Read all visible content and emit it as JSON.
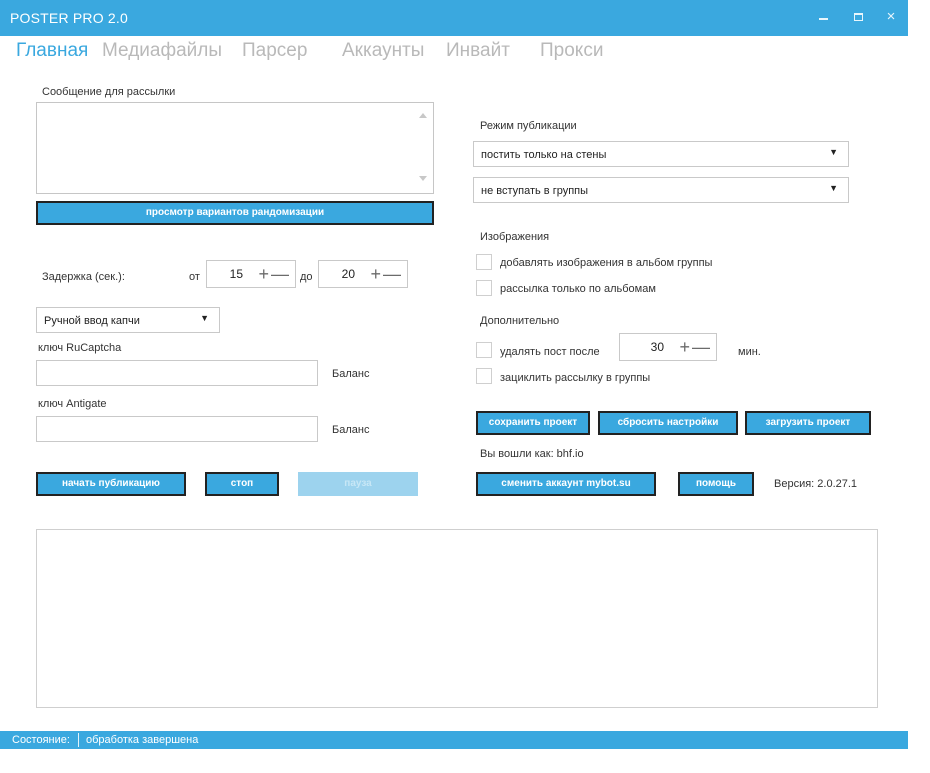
{
  "window": {
    "title": "POSTER PRO 2.0",
    "min_label": "",
    "max_label": "",
    "close_label": "×"
  },
  "tabs": [
    {
      "label": "Главная",
      "active": true
    },
    {
      "label": "Медиафайлы"
    },
    {
      "label": "Парсер"
    },
    {
      "label": "Аккаунты"
    },
    {
      "label": "Инвайт"
    },
    {
      "label": "Прокси"
    }
  ],
  "left": {
    "message_label": "Сообщение для рассылки",
    "message_value": "",
    "randomize_button": "просмотр вариантов рандомизации",
    "delay_label": "Задержка  (сек.):",
    "from_label": "от",
    "from_value": "15",
    "to_label": "до",
    "to_value": "20",
    "spin_plus": "+",
    "spin_minus": "—",
    "captcha_select": "Ручной ввод капчи",
    "select_arrow": "▼",
    "rucaptcha_label": "ключ RuCaptcha",
    "rucaptcha_value": "",
    "rucaptcha_balance": "Баланс",
    "antigate_label": "ключ Antigate",
    "antigate_value": "",
    "antigate_balance": "Баланс",
    "start_button": "начать публикацию",
    "stop_button": "стоп",
    "pause_button": "пауза"
  },
  "right": {
    "mode_label": "Режим публикации",
    "post_mode_select": "постить только на стены",
    "join_select": "не вступать в группы",
    "images_label": "Изображения",
    "cb_album": "добавлять изображения в альбом группы",
    "cb_albums_only": "рассылка только по альбомам",
    "extra_label": "Дополнительно",
    "cb_delete": "удалять пост после",
    "delete_value": "30",
    "minutes_label": "мин.",
    "cb_loop": "зациклить рассылку в группы",
    "save_button": "сохранить проект",
    "reset_button": "сбросить настройки",
    "load_button": "загрузить проект",
    "logged_in": "Вы вошли как: bhf.io",
    "switch_button": "сменить аккаунт mybot.su",
    "help_button": "помощь",
    "version": "Версия: 2.0.27.1"
  },
  "status": {
    "label": "Состояние:",
    "value": "обработка завершена"
  },
  "colors": {
    "accent": "#3aa8df",
    "tab_inactive": "#b9b9b9"
  }
}
